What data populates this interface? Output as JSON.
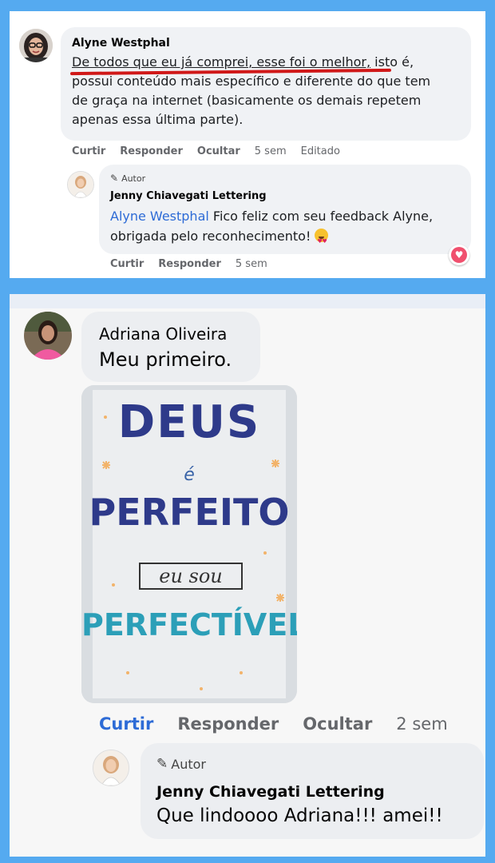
{
  "comment1": {
    "author": "Alyne Westphal",
    "text_line1_underlined": "De todos que eu já comprei, esse foi o melhor,",
    "text_line1_rest": " isto é,",
    "text_line2": "possui conteúdo mais específico e diferente do que tem",
    "text_line3": "de graça na internet (basicamente os demais repetem",
    "text_line4": "apenas essa última parte).",
    "actions": {
      "like": "Curtir",
      "reply": "Responder",
      "hide": "Ocultar",
      "time": "5 sem",
      "edited": "Editado"
    }
  },
  "reply1": {
    "badge": "Autor",
    "author": "Jenny Chiavegati Lettering",
    "mention": "Alyne Westphal",
    "text_line1": " Fico feliz com seu feedback Alyne,",
    "text_line2": "obrigada pelo reconhecimento!",
    "actions": {
      "like": "Curtir",
      "reply": "Responder",
      "time": "5 sem"
    }
  },
  "comment2": {
    "author": "Adriana Oliveira",
    "text": "Meu primeiro.",
    "image_text": {
      "line1": "DEUS",
      "line2": "é",
      "line3": "PERFEITO",
      "line4": "eu sou",
      "line5": "PERFECTÍVEL"
    },
    "actions": {
      "like": "Curtir",
      "reply": "Responder",
      "hide": "Ocultar",
      "time": "2 sem"
    }
  },
  "reply2": {
    "badge": "Autor",
    "author": "Jenny Chiavegati Lettering",
    "text": "Que lindoooo Adriana!!! amei!!"
  },
  "colors": {
    "link": "#2d6bd6",
    "underline": "#d01818",
    "like_active": "#2d6bd6",
    "reaction_heart": "#f0506e"
  }
}
